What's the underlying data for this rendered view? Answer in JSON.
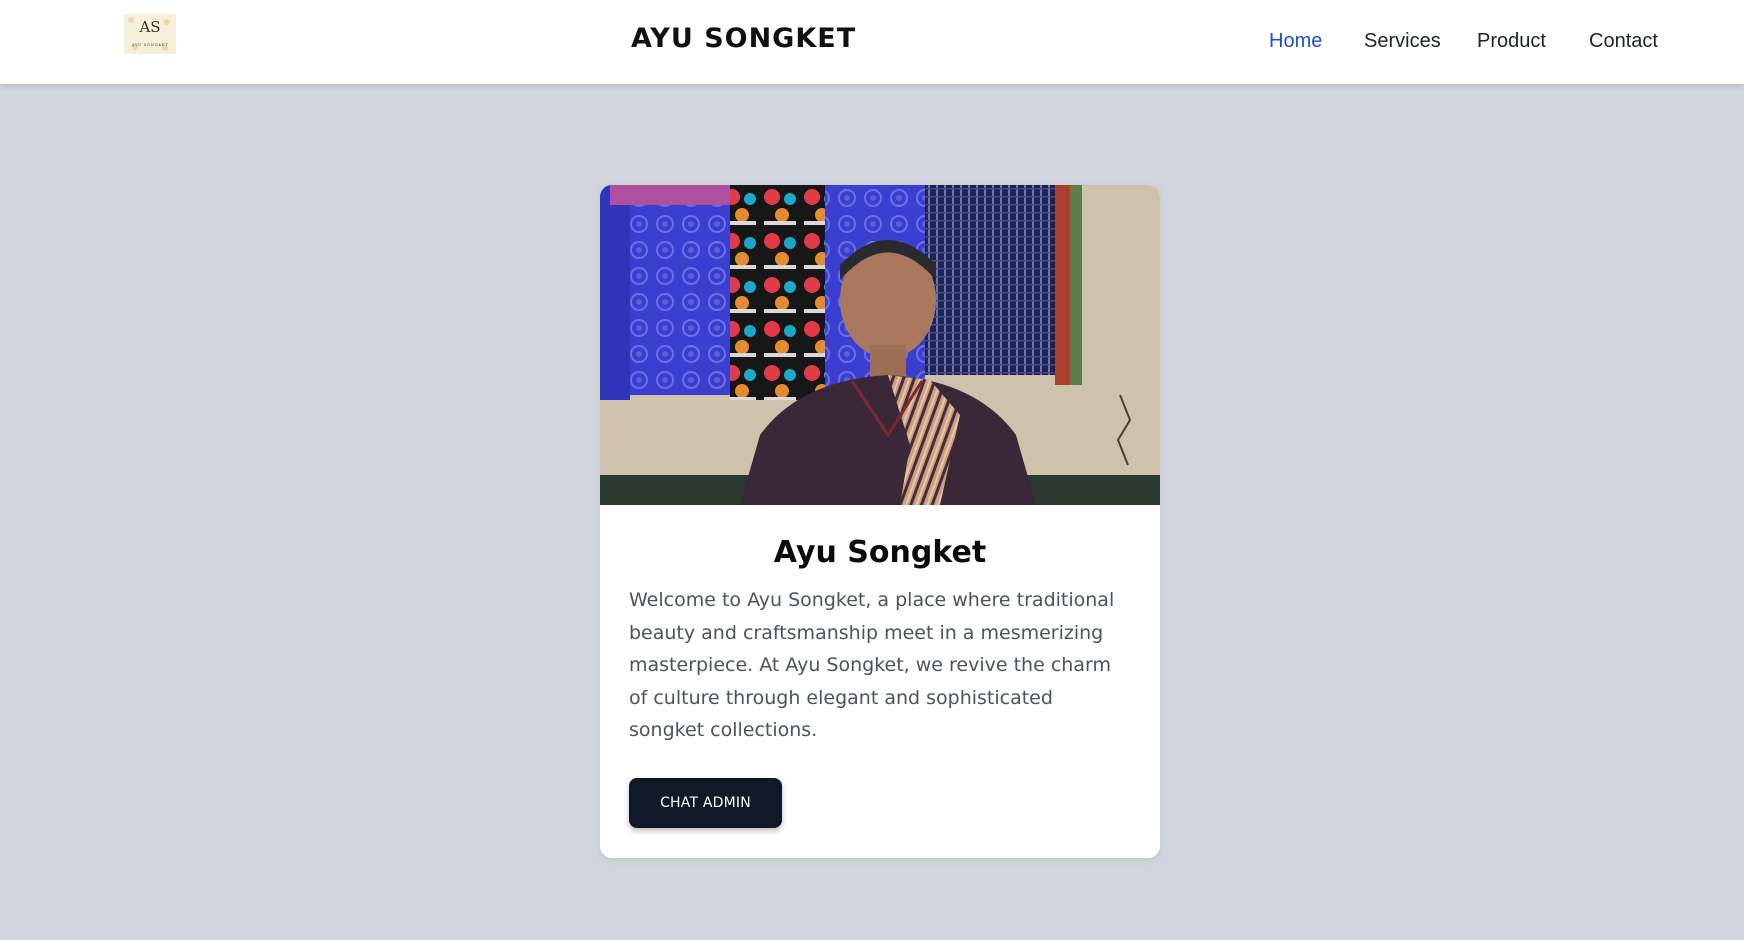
{
  "header": {
    "brand": "AYU SONGKET",
    "logo": {
      "monogram": "AS",
      "small_text": "AYU SONGKET"
    },
    "nav": [
      {
        "label": "Home",
        "active": true
      },
      {
        "label": "Services",
        "active": false
      },
      {
        "label": "Product",
        "active": false
      },
      {
        "label": "Contact",
        "active": false
      }
    ]
  },
  "card": {
    "title": "Ayu Songket",
    "description": "Welcome to Ayu Songket, a place where traditional beauty and craftsmanship meet in a mesmerizing masterpiece. At Ayu Songket, we revive the charm of culture through elegant and sophisticated songket collections.",
    "button_label": "CHAT ADMIN"
  },
  "colors": {
    "page_background": "#d1d5de",
    "nav_active": "#1d4ed8",
    "button_background": "#111827"
  }
}
